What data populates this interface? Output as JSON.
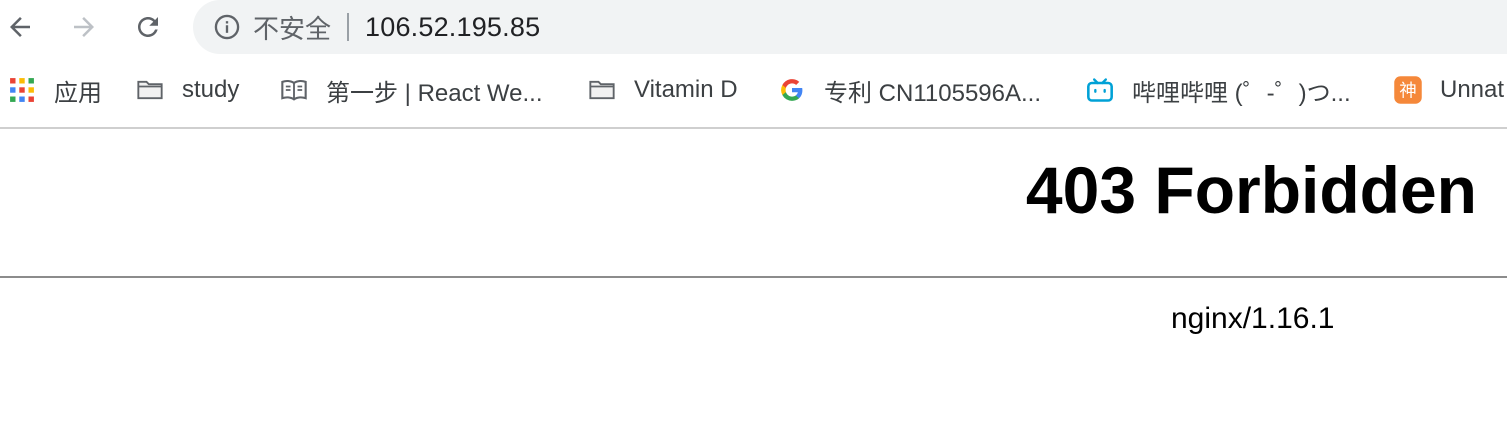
{
  "browser": {
    "security_label": "不安全",
    "url": "106.52.195.85"
  },
  "bookmarks": [
    {
      "label": "应用",
      "icon": "apps-grid-icon"
    },
    {
      "label": "study",
      "icon": "folder-icon"
    },
    {
      "label": "第一步 | React We...",
      "icon": "book-icon"
    },
    {
      "label": "Vitamin D",
      "icon": "folder-icon"
    },
    {
      "label": "专利 CN1105596A...",
      "icon": "google-icon"
    },
    {
      "label": "哔哩哔哩 (゜-゜)つ...",
      "icon": "bilibili-icon"
    },
    {
      "label": "Unnat",
      "icon": "shen-icon"
    }
  ],
  "page": {
    "heading": "403 Forbidden",
    "server": "nginx/1.16.1"
  },
  "colors": {
    "omnibox_bg": "#f1f3f4",
    "bilibili_blue": "#00a1d6",
    "shen_orange": "#f5883a"
  }
}
